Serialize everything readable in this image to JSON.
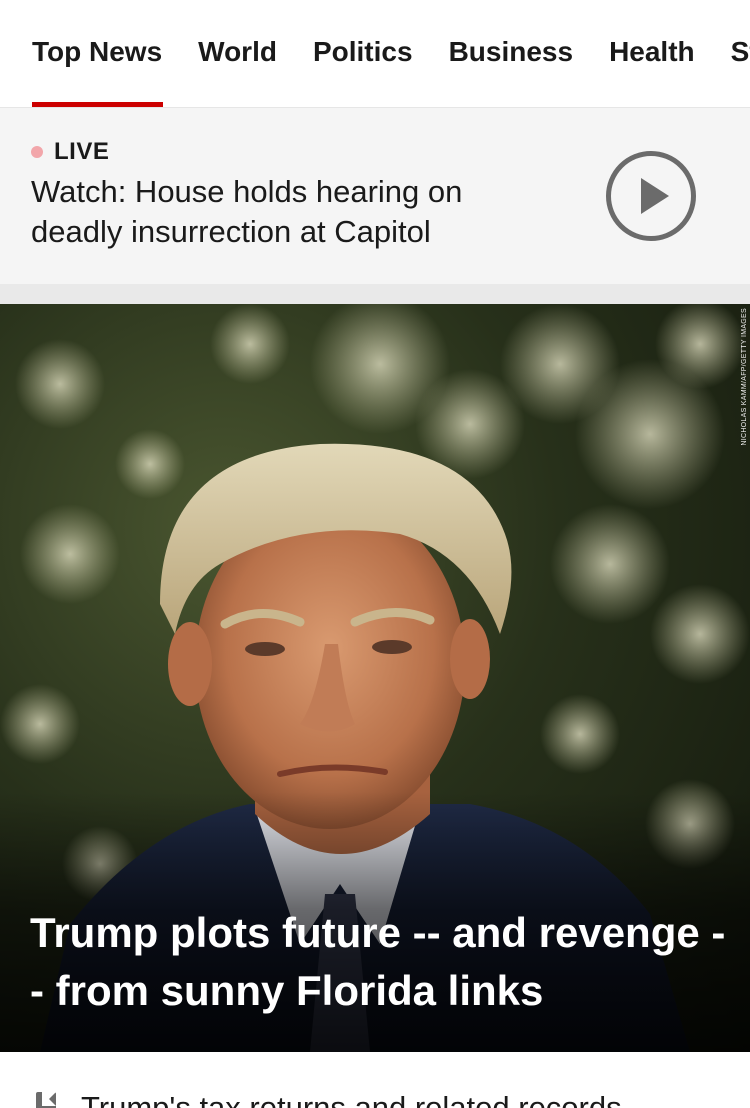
{
  "tabs": [
    {
      "label": "Top News",
      "active": true
    },
    {
      "label": "World",
      "active": false
    },
    {
      "label": "Politics",
      "active": false
    },
    {
      "label": "Business",
      "active": false
    },
    {
      "label": "Health",
      "active": false
    },
    {
      "label": "Sty",
      "active": false
    }
  ],
  "live": {
    "badge": "LIVE",
    "headline": "Watch: House holds hearing on deadly insurrection at Capitol",
    "action_icon": "play-circle-icon"
  },
  "hero": {
    "headline": "Trump plots future -- and revenge -- from sunny Florida links",
    "photo_credit": "NICHOLAS KAMM/AFP/GETTY IMAGES"
  },
  "next_story": {
    "icon": "document-icon",
    "headline": "Trump's tax returns and related records"
  },
  "colors": {
    "accent": "#cc0000",
    "live_dot": "#f2a6aa",
    "play_icon": "#6b6b6b"
  }
}
